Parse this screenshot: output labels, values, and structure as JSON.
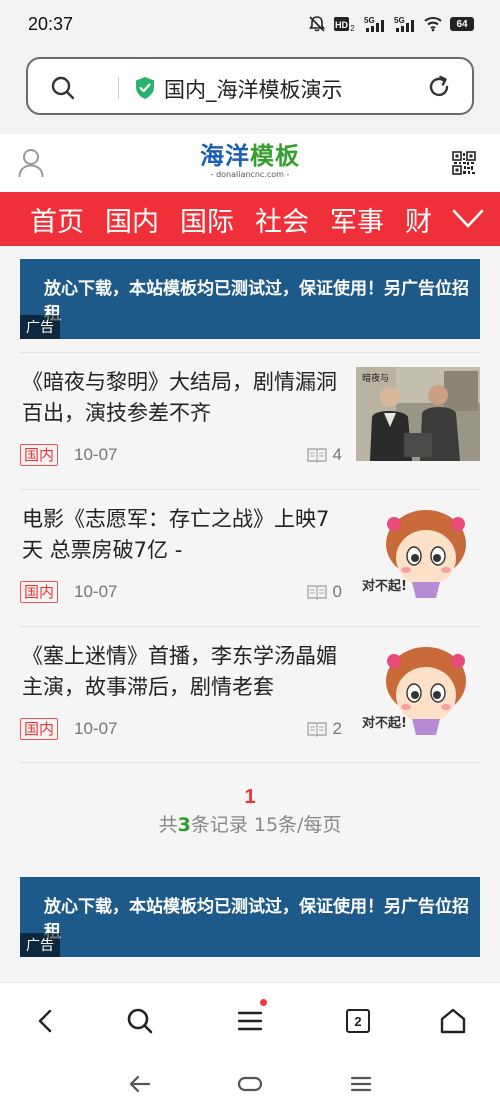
{
  "status": {
    "time": "20:37",
    "battery": "64",
    "icons": [
      "mute-icon",
      "hd-icon",
      "signal-5g-icon",
      "signal-5g-icon",
      "wifi-icon",
      "battery-icon"
    ]
  },
  "browser": {
    "url_text": "国内_海洋模板演示",
    "icons": [
      "search-icon",
      "shield-check-icon",
      "reload-icon"
    ]
  },
  "site": {
    "logo_main_blue": "海洋",
    "logo_main_green": "模板",
    "logo_sub": "- donaliancnc.com -",
    "colors": {
      "blue": "#1b5fb5",
      "green": "#36a02f",
      "nav_red": "#ef3038"
    }
  },
  "nav": {
    "items": [
      "首页",
      "国内",
      "国际",
      "社会",
      "军事",
      "财"
    ]
  },
  "ads": [
    {
      "text": "放心下载，本站模板均已测试过，保证使用！另广告位招租",
      "tag": "广告"
    },
    {
      "text": "放心下载，本站模板均已测试过，保证使用！另广告位招租",
      "tag": "广告"
    }
  ],
  "news": [
    {
      "title": "《暗夜与黎明》大结局，剧情漏洞百出，演技参差不齐",
      "category": "国内",
      "date": "10-07",
      "count": "4",
      "thumb": "photo"
    },
    {
      "title": "电影《志愿军：存亡之战》上映7天 总票房破7亿 -",
      "category": "国内",
      "date": "10-07",
      "count": "0",
      "thumb": "cartoon",
      "thumb_text": "对不起!"
    },
    {
      "title": "《塞上迷情》首播，李东学汤晶媚主演，故事滞后，剧情老套",
      "category": "国内",
      "date": "10-07",
      "count": "2",
      "thumb": "cartoon",
      "thumb_text": "对不起!"
    }
  ],
  "pager": {
    "current": "1",
    "info_prefix": "共",
    "total": "3",
    "info_suffix": "条记录 15条/每页"
  },
  "bottom_bar": {
    "tab_count": "2",
    "icons": [
      "back-icon",
      "search-icon",
      "menu-icon",
      "tabs-icon",
      "home-icon"
    ]
  }
}
